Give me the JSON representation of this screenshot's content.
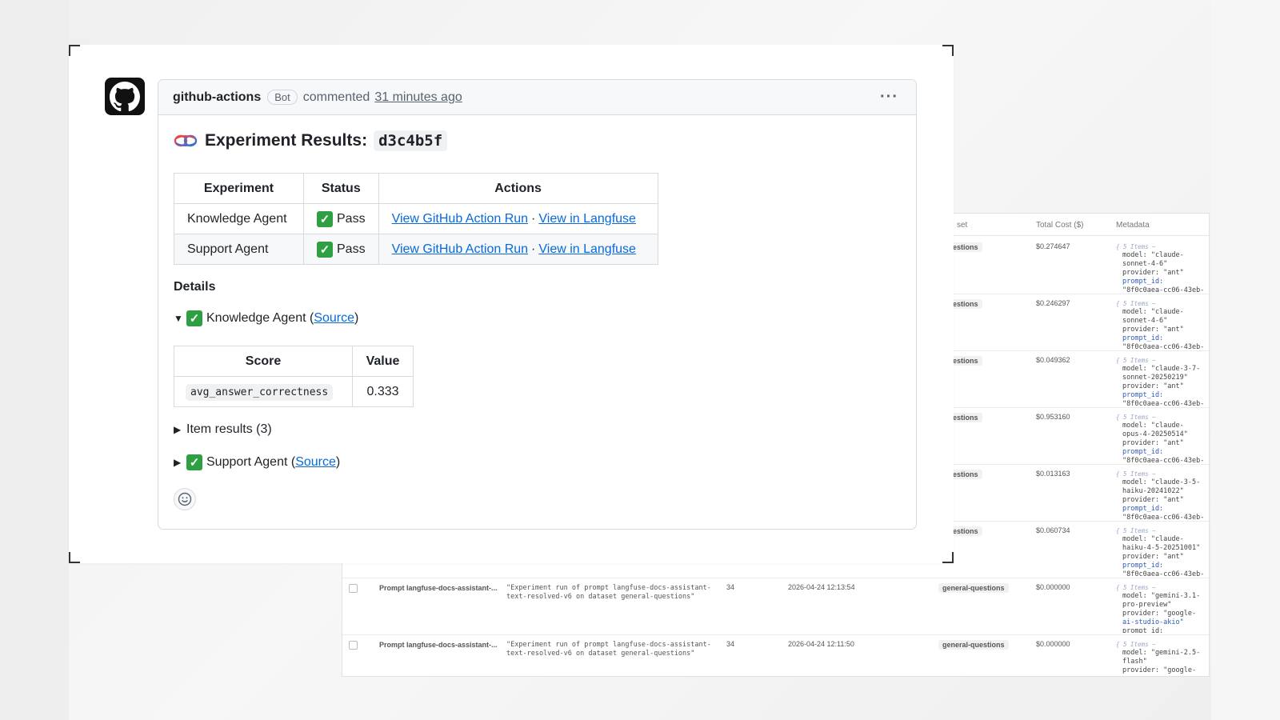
{
  "table": {
    "headers": {
      "dataset": "set",
      "total_cost": "Total Cost ($)",
      "metadata": "Metadata"
    },
    "rows": [
      {
        "name": "",
        "description": "",
        "count": "",
        "date": "",
        "dataset": "eral-questions",
        "cost": "$0.274647",
        "meta": {
          "items": "{ 5 Items ~",
          "line1": "model: \"claude-",
          "line2": "sonnet-4-6\"",
          "line3": "provider: \"ant\"",
          "line4": "prompt_id:",
          "line5": "\"8f0c0aea-cc06-43eb-"
        }
      },
      {
        "name": "",
        "description": "",
        "count": "",
        "date": "",
        "dataset": "eral-questions",
        "cost": "$0.246297",
        "meta": {
          "items": "{ 5 Items ~",
          "line1": "model: \"claude-",
          "line2": "sonnet-4-6\"",
          "line3": "provider: \"ant\"",
          "line4": "prompt_id:",
          "line5": "\"8f0c0aea-cc06-43eb-"
        }
      },
      {
        "name": "",
        "description": "",
        "count": "",
        "date": "",
        "dataset": "eral-questions",
        "cost": "$0.049362",
        "meta": {
          "items": "{ 5 Items ~",
          "line1": "model: \"claude-3-7-",
          "line2": "sonnet-20250219\"",
          "line3": "provider: \"ant\"",
          "line4": "prompt_id:",
          "line5": "\"8f0c0aea-cc06-43eb-"
        }
      },
      {
        "name": "",
        "description": "",
        "count": "",
        "date": "",
        "dataset": "eral-questions",
        "cost": "$0.953160",
        "meta": {
          "items": "{ 5 Items ~",
          "line1": "model: \"claude-",
          "line2": "opus-4-20250514\"",
          "line3": "provider: \"ant\"",
          "line4": "prompt_id:",
          "line5": "\"8f0c0aea-cc06-43eb-"
        }
      },
      {
        "name": "",
        "description": "",
        "count": "",
        "date": "",
        "dataset": "eral-questions",
        "cost": "$0.013163",
        "meta": {
          "items": "{ 5 Items ~",
          "line1": "model: \"claude-3-5-",
          "line2": "haiku-20241022\"",
          "line3": "provider: \"ant\"",
          "line4": "prompt_id:",
          "line5": "\"8f0c0aea-cc06-43eb-"
        }
      },
      {
        "name": "",
        "description": "",
        "count": "",
        "date": "",
        "dataset": "eral-questions",
        "cost": "$0.060734",
        "meta": {
          "items": "{ 5 Items ~",
          "line1": "model: \"claude-",
          "line2": "haiku-4-5-20251001\"",
          "line3": "provider: \"ant\"",
          "line4": "prompt_id:",
          "line5": "\"8f0c0aea-cc06-43eb-"
        }
      },
      {
        "name": "Prompt langfuse-docs-assistant-...",
        "description": "\"Experiment run of prompt langfuse-docs-assistant-text-resolved-v6 on dataset general-questions\"",
        "count": "34",
        "date": "2026-04-24 12:13:54",
        "dataset": "general-questions",
        "cost": "$0.000000",
        "meta": {
          "items": "{ 5 Items ~",
          "line1": "model: \"gemini-3.1-",
          "line2": "pro-preview\"",
          "line3": "provider: \"google-",
          "line4": "ai-studio-akio\"",
          "line5": "prompt_id:"
        }
      },
      {
        "name": "Prompt langfuse-docs-assistant-...",
        "description": "\"Experiment run of prompt langfuse-docs-assistant-text-resolved-v6 on dataset general-questions\"",
        "count": "34",
        "date": "2026-04-24 12:11:50",
        "dataset": "general-questions",
        "cost": "$0.000000",
        "meta": {
          "items": "{ 5 Items ~",
          "line1": "model: \"gemini-2.5-",
          "line2": "flash\"",
          "line3": "provider: \"google-",
          "line4": "",
          "line5": ""
        }
      }
    ]
  },
  "comment": {
    "author": "github-actions",
    "badge": "Bot",
    "action": "commented",
    "time": "31 minutes ago",
    "more": "···",
    "title": "Experiment Results:",
    "commit": "d3c4b5f",
    "results": {
      "headers": [
        "Experiment",
        "Status",
        "Actions"
      ],
      "rows": [
        {
          "experiment": "Knowledge Agent",
          "status": "Pass",
          "action1": "View GitHub Action Run",
          "sep": "·",
          "action2": "View in Langfuse"
        },
        {
          "experiment": "Support Agent",
          "status": "Pass",
          "action1": "View GitHub Action Run",
          "sep": "·",
          "action2": "View in Langfuse"
        }
      ]
    },
    "details_heading": "Details",
    "knowledge": {
      "label": "Knowledge Agent (",
      "source": "Source",
      "close": ")"
    },
    "scores": {
      "headers": [
        "Score",
        "Value"
      ],
      "rows": [
        {
          "name": "avg_answer_correctness",
          "value": "0.333"
        }
      ]
    },
    "item_results": "Item results (3)",
    "support": {
      "label": "Support Agent (",
      "source": "Source",
      "close": ")"
    }
  },
  "colors": {
    "link": "#0969da",
    "pass": "#2ea043",
    "border": "#d7dbe0"
  }
}
